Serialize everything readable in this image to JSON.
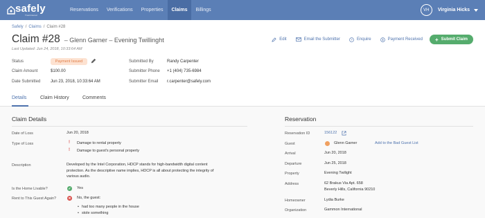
{
  "nav": {
    "logo_name": "safely",
    "logo_tag": "Trust Insured",
    "items": [
      "Reservations",
      "Verifications",
      "Properties",
      "Claims",
      "Billings"
    ],
    "user_initials": "VH",
    "user_name": "Virginia Hicks"
  },
  "breadcrumb": [
    "Safely",
    "Claims",
    "Claim #28"
  ],
  "breadcrumb_sep": "/",
  "header": {
    "title": "Claim #28",
    "subtitle": "– Glenn Garner – Evening Twillinght",
    "last_updated": "Last Updated: Jun 24, 2018, 10:33:64 AM"
  },
  "actions": {
    "edit": "Edit",
    "email": "Email the Submitter",
    "enquire": "Enquire",
    "payment": "Payment Received",
    "submit": "Submit Claim",
    "submit_plus": "+"
  },
  "summary": {
    "status_label": "Status",
    "status_value": "Payment Issued",
    "amount_label": "Claim Amount",
    "amount_value": "$100.00",
    "date_label": "Date Submitted",
    "date_value": "Jun 23, 2018, 10:33:64 AM",
    "by_label": "Submitted By",
    "by_value": "Randy Carpenter",
    "phone_label": "Submitter Phone",
    "phone_value": "+1 (404) 735-6984",
    "email_label": "Submitter Email",
    "email_value": "r.carpenter@safely.com"
  },
  "tabs": [
    "Details",
    "Claim History",
    "Comments"
  ],
  "details": {
    "title": "Claim Details",
    "date_of_loss_label": "Date of Loss",
    "date_of_loss": "Jun 20, 2018",
    "type_label": "Type of Loss",
    "types": [
      "Damage to rental property",
      "Damage to guest's personal property"
    ],
    "desc_label": "Description",
    "desc_lines": [
      "Developed by the Intel Corporation, HDCP stands for high-bandwidth digital content",
      "protection. As the descriptive name implies, HDCP is all about protecting the integrity of",
      "various audio."
    ],
    "livable_label": "Is the Home Livable?",
    "livable_value": "Yes",
    "rent_label": "Rent to This Guest Again?",
    "rent_value": "No, the guest:",
    "rent_reasons": [
      "had too many people in the house",
      "stole something"
    ],
    "warn_mark": "!",
    "yes_mark": "✓",
    "no_mark": "✕"
  },
  "reservation": {
    "title": "Reservation",
    "id_label": "Reservation ID",
    "id_value": "156122",
    "guest_label": "Guest",
    "guest_value": "Glenn Garner",
    "bad_guest_link": "Add to the Bad Guest List",
    "arrival_label": "Arrival",
    "arrival_value": "Jun 20, 2018",
    "departure_label": "Departure",
    "departure_value": "Jun 25, 2018",
    "property_label": "Property",
    "property_value": "Evening Twilight",
    "address_label": "Address",
    "address_lines": [
      "62 Brakus Via Apt. 658",
      "Beverly Hills, California 90210"
    ],
    "homeowner_label": "Homeowner",
    "homeowner_value": "Lydia Burke",
    "org_label": "Organization",
    "org_value": "Gammon International"
  },
  "colors": {
    "nav_bg": "#5b7fb6",
    "accent": "#4d72ad",
    "submit_green": "#55ac6d",
    "badge_bg": "#fde2d1",
    "badge_text": "#e07c46",
    "warn_red": "#d9534f"
  }
}
